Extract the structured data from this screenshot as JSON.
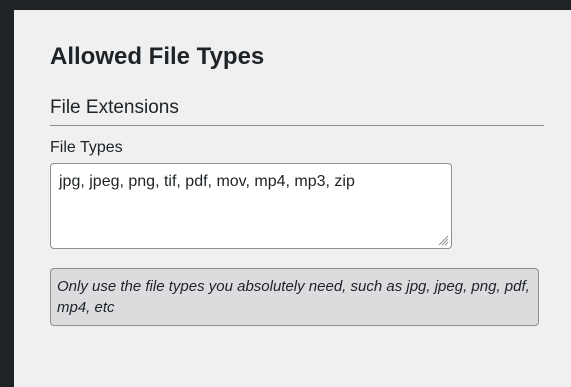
{
  "panel": {
    "title": "Allowed File Types",
    "section_heading": "File Extensions"
  },
  "file_types_field": {
    "label": "File Types",
    "value": "jpg, jpeg, png, tif, pdf, mov, mp4, mp3, zip"
  },
  "help_text": "Only use the file types you absolutely need, such as jpg, jpeg, png, pdf, mp4, etc",
  "icons": {
    "resize_handle": "resize-grip-icon"
  },
  "colors": {
    "outer_background": "#1d2327",
    "panel_background": "#f0f0f1",
    "border": "#8c8f94",
    "help_background": "#dcdcde",
    "text": "#1d2327"
  }
}
